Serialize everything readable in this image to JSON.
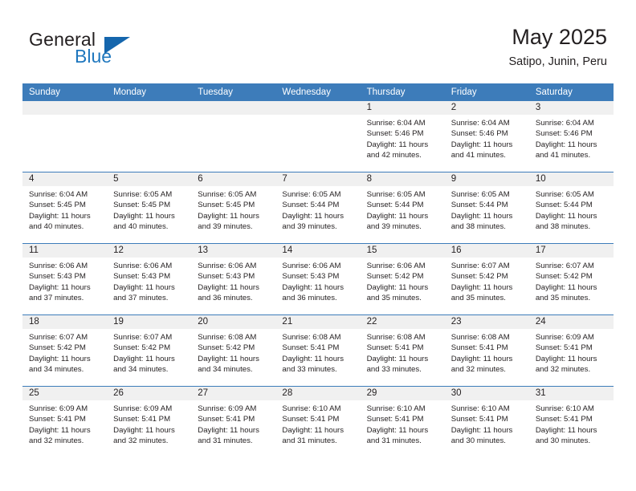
{
  "logo": {
    "word1": "General",
    "word2": "Blue",
    "accent_color": "#1f77be"
  },
  "header": {
    "title": "May 2025",
    "subtitle": "Satipo, Junin, Peru"
  },
  "calendar": {
    "header_color": "#3d7cba",
    "weekdays": [
      "Sunday",
      "Monday",
      "Tuesday",
      "Wednesday",
      "Thursday",
      "Friday",
      "Saturday"
    ],
    "weeks": [
      [
        {
          "day": "",
          "lines": []
        },
        {
          "day": "",
          "lines": []
        },
        {
          "day": "",
          "lines": []
        },
        {
          "day": "",
          "lines": []
        },
        {
          "day": "1",
          "lines": [
            "Sunrise: 6:04 AM",
            "Sunset: 5:46 PM",
            "Daylight: 11 hours",
            "and 42 minutes."
          ]
        },
        {
          "day": "2",
          "lines": [
            "Sunrise: 6:04 AM",
            "Sunset: 5:46 PM",
            "Daylight: 11 hours",
            "and 41 minutes."
          ]
        },
        {
          "day": "3",
          "lines": [
            "Sunrise: 6:04 AM",
            "Sunset: 5:46 PM",
            "Daylight: 11 hours",
            "and 41 minutes."
          ]
        }
      ],
      [
        {
          "day": "4",
          "lines": [
            "Sunrise: 6:04 AM",
            "Sunset: 5:45 PM",
            "Daylight: 11 hours",
            "and 40 minutes."
          ]
        },
        {
          "day": "5",
          "lines": [
            "Sunrise: 6:05 AM",
            "Sunset: 5:45 PM",
            "Daylight: 11 hours",
            "and 40 minutes."
          ]
        },
        {
          "day": "6",
          "lines": [
            "Sunrise: 6:05 AM",
            "Sunset: 5:45 PM",
            "Daylight: 11 hours",
            "and 39 minutes."
          ]
        },
        {
          "day": "7",
          "lines": [
            "Sunrise: 6:05 AM",
            "Sunset: 5:44 PM",
            "Daylight: 11 hours",
            "and 39 minutes."
          ]
        },
        {
          "day": "8",
          "lines": [
            "Sunrise: 6:05 AM",
            "Sunset: 5:44 PM",
            "Daylight: 11 hours",
            "and 39 minutes."
          ]
        },
        {
          "day": "9",
          "lines": [
            "Sunrise: 6:05 AM",
            "Sunset: 5:44 PM",
            "Daylight: 11 hours",
            "and 38 minutes."
          ]
        },
        {
          "day": "10",
          "lines": [
            "Sunrise: 6:05 AM",
            "Sunset: 5:44 PM",
            "Daylight: 11 hours",
            "and 38 minutes."
          ]
        }
      ],
      [
        {
          "day": "11",
          "lines": [
            "Sunrise: 6:06 AM",
            "Sunset: 5:43 PM",
            "Daylight: 11 hours",
            "and 37 minutes."
          ]
        },
        {
          "day": "12",
          "lines": [
            "Sunrise: 6:06 AM",
            "Sunset: 5:43 PM",
            "Daylight: 11 hours",
            "and 37 minutes."
          ]
        },
        {
          "day": "13",
          "lines": [
            "Sunrise: 6:06 AM",
            "Sunset: 5:43 PM",
            "Daylight: 11 hours",
            "and 36 minutes."
          ]
        },
        {
          "day": "14",
          "lines": [
            "Sunrise: 6:06 AM",
            "Sunset: 5:43 PM",
            "Daylight: 11 hours",
            "and 36 minutes."
          ]
        },
        {
          "day": "15",
          "lines": [
            "Sunrise: 6:06 AM",
            "Sunset: 5:42 PM",
            "Daylight: 11 hours",
            "and 35 minutes."
          ]
        },
        {
          "day": "16",
          "lines": [
            "Sunrise: 6:07 AM",
            "Sunset: 5:42 PM",
            "Daylight: 11 hours",
            "and 35 minutes."
          ]
        },
        {
          "day": "17",
          "lines": [
            "Sunrise: 6:07 AM",
            "Sunset: 5:42 PM",
            "Daylight: 11 hours",
            "and 35 minutes."
          ]
        }
      ],
      [
        {
          "day": "18",
          "lines": [
            "Sunrise: 6:07 AM",
            "Sunset: 5:42 PM",
            "Daylight: 11 hours",
            "and 34 minutes."
          ]
        },
        {
          "day": "19",
          "lines": [
            "Sunrise: 6:07 AM",
            "Sunset: 5:42 PM",
            "Daylight: 11 hours",
            "and 34 minutes."
          ]
        },
        {
          "day": "20",
          "lines": [
            "Sunrise: 6:08 AM",
            "Sunset: 5:42 PM",
            "Daylight: 11 hours",
            "and 34 minutes."
          ]
        },
        {
          "day": "21",
          "lines": [
            "Sunrise: 6:08 AM",
            "Sunset: 5:41 PM",
            "Daylight: 11 hours",
            "and 33 minutes."
          ]
        },
        {
          "day": "22",
          "lines": [
            "Sunrise: 6:08 AM",
            "Sunset: 5:41 PM",
            "Daylight: 11 hours",
            "and 33 minutes."
          ]
        },
        {
          "day": "23",
          "lines": [
            "Sunrise: 6:08 AM",
            "Sunset: 5:41 PM",
            "Daylight: 11 hours",
            "and 32 minutes."
          ]
        },
        {
          "day": "24",
          "lines": [
            "Sunrise: 6:09 AM",
            "Sunset: 5:41 PM",
            "Daylight: 11 hours",
            "and 32 minutes."
          ]
        }
      ],
      [
        {
          "day": "25",
          "lines": [
            "Sunrise: 6:09 AM",
            "Sunset: 5:41 PM",
            "Daylight: 11 hours",
            "and 32 minutes."
          ]
        },
        {
          "day": "26",
          "lines": [
            "Sunrise: 6:09 AM",
            "Sunset: 5:41 PM",
            "Daylight: 11 hours",
            "and 32 minutes."
          ]
        },
        {
          "day": "27",
          "lines": [
            "Sunrise: 6:09 AM",
            "Sunset: 5:41 PM",
            "Daylight: 11 hours",
            "and 31 minutes."
          ]
        },
        {
          "day": "28",
          "lines": [
            "Sunrise: 6:10 AM",
            "Sunset: 5:41 PM",
            "Daylight: 11 hours",
            "and 31 minutes."
          ]
        },
        {
          "day": "29",
          "lines": [
            "Sunrise: 6:10 AM",
            "Sunset: 5:41 PM",
            "Daylight: 11 hours",
            "and 31 minutes."
          ]
        },
        {
          "day": "30",
          "lines": [
            "Sunrise: 6:10 AM",
            "Sunset: 5:41 PM",
            "Daylight: 11 hours",
            "and 30 minutes."
          ]
        },
        {
          "day": "31",
          "lines": [
            "Sunrise: 6:10 AM",
            "Sunset: 5:41 PM",
            "Daylight: 11 hours",
            "and 30 minutes."
          ]
        }
      ]
    ]
  }
}
